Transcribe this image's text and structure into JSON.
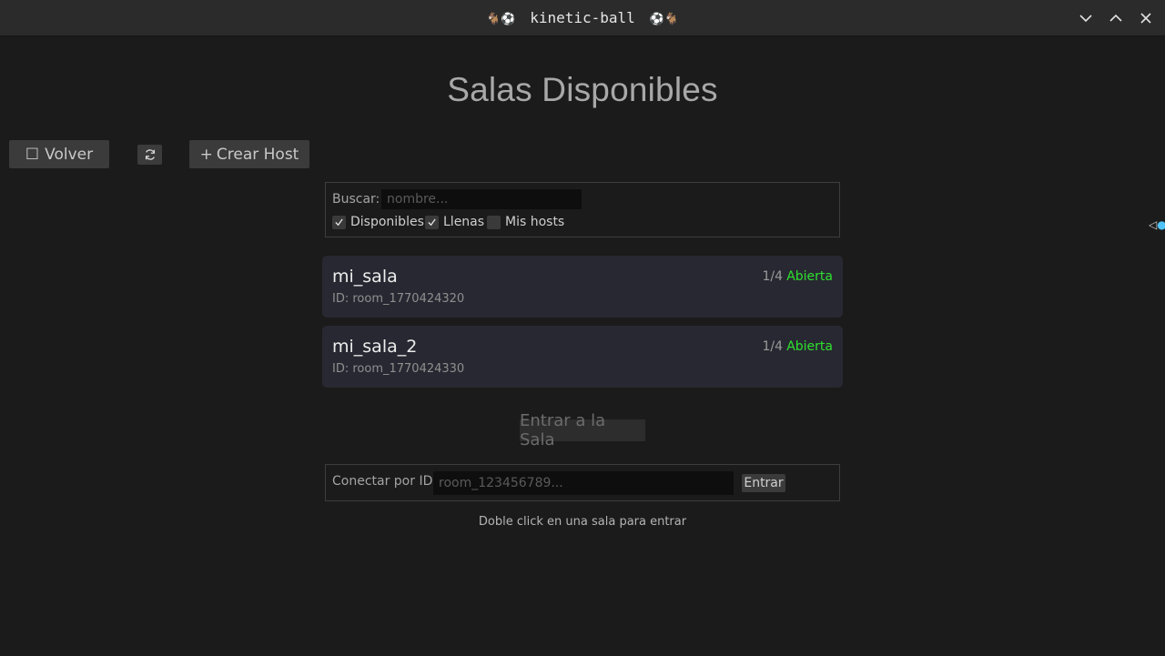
{
  "window": {
    "title": "kinetic-ball",
    "title_prefix": "🐐⚽",
    "title_suffix": "⚽🐐"
  },
  "page": {
    "heading": "Salas Disponibles"
  },
  "toolbar": {
    "back_label": "Volver",
    "back_icon": "☐",
    "refresh_icon": "refresh-icon",
    "create_host_label": "Crear Host",
    "create_host_icon": "+"
  },
  "filters": {
    "search_label": "Buscar:",
    "search_placeholder": "nombre...",
    "search_value": "",
    "checkboxes": [
      {
        "label": "Disponibles",
        "checked": true
      },
      {
        "label": "Llenas",
        "checked": true
      },
      {
        "label": "Mis hosts",
        "checked": false
      }
    ]
  },
  "rooms": [
    {
      "name": "mi_sala",
      "id": "ID: room_1770424320",
      "players": "1/4",
      "status": "Abierta"
    },
    {
      "name": "mi_sala_2",
      "id": "ID: room_1770424330",
      "players": "1/4",
      "status": "Abierta"
    }
  ],
  "colors": {
    "status_open": "#2ee02e",
    "background": "#1b1b1b",
    "card": "#282832"
  },
  "join": {
    "enter_room_label": "Entrar a la Sala",
    "connect_label": "Conectar por ID:",
    "connect_placeholder": "room_123456789...",
    "connect_value": "",
    "enter_label": "Entrar",
    "hint": "Doble click en una sala para entrar"
  },
  "edge_marker": "◁"
}
